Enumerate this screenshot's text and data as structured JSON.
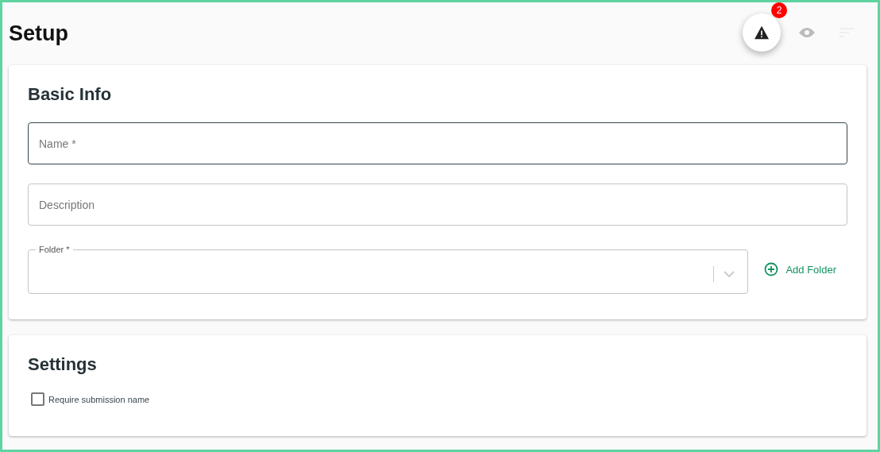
{
  "page": {
    "title": "Setup"
  },
  "toolbar": {
    "alert_badge": "2"
  },
  "basic_info": {
    "title": "Basic Info",
    "fields": [
      {
        "kind": "text",
        "placeholder": "Name *",
        "focused": true
      },
      {
        "kind": "text",
        "placeholder": "Description",
        "focused": false
      },
      {
        "kind": "select",
        "label": "Folder *",
        "focused": false
      }
    ],
    "add_button": "Add Folder"
  },
  "settings": {
    "title": "Settings",
    "options": [
      {
        "label": "Require submission name",
        "checked": false
      }
    ]
  }
}
